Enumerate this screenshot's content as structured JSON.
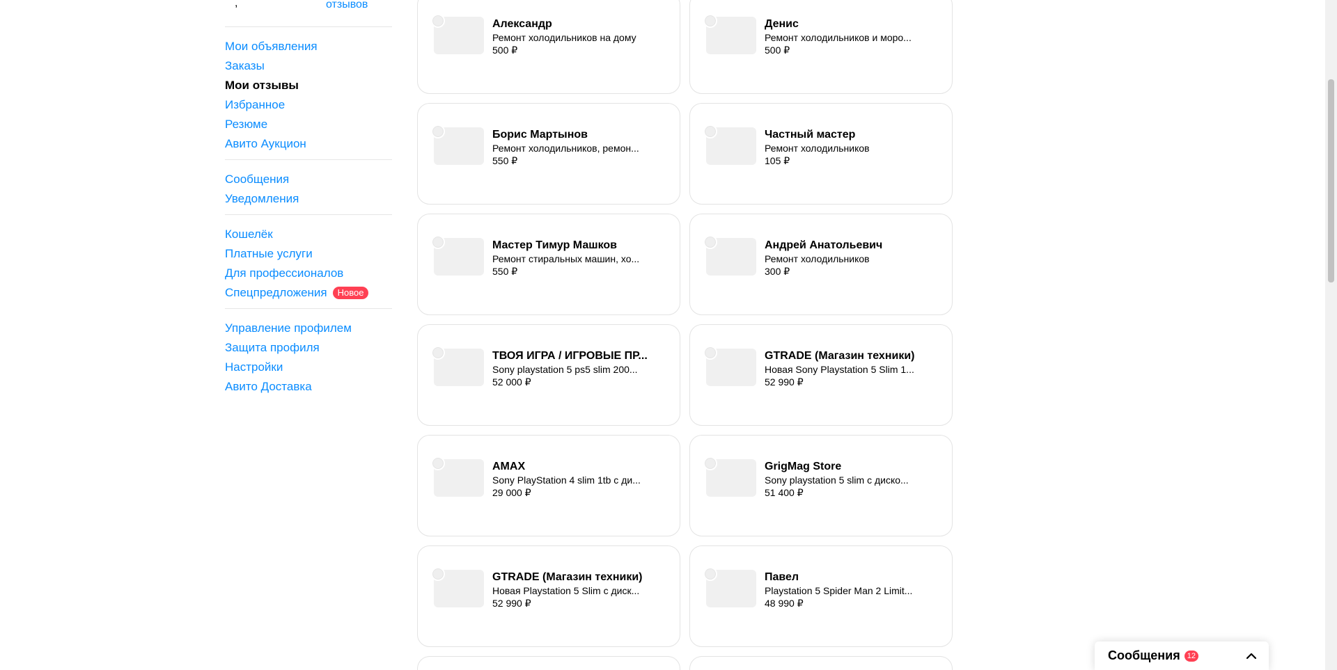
{
  "sidebar": {
    "top_fragment": {
      "reviews_text": "отзывов"
    },
    "groups": [
      {
        "items": [
          {
            "label": "Мои объявления"
          },
          {
            "label": "Заказы"
          },
          {
            "label": "Мои отзывы",
            "active": true
          },
          {
            "label": "Избранное"
          },
          {
            "label": "Резюме"
          },
          {
            "label": "Авито Аукцион"
          }
        ]
      },
      {
        "items": [
          {
            "label": "Сообщения"
          },
          {
            "label": "Уведомления"
          }
        ]
      },
      {
        "items": [
          {
            "label": "Кошелёк"
          },
          {
            "label": "Платные услуги"
          },
          {
            "label": "Для профессионалов"
          },
          {
            "label": "Спецпредложения",
            "badge": "Новое"
          }
        ]
      },
      {
        "items": [
          {
            "label": "Управление профилем"
          },
          {
            "label": "Защита профиля"
          },
          {
            "label": "Настройки"
          },
          {
            "label": "Авито Доставка"
          }
        ]
      }
    ]
  },
  "cards": [
    {
      "name": "Александр",
      "desc": "Ремонт холодильников на дому",
      "price": "500 ₽"
    },
    {
      "name": "Денис",
      "desc": "Ремонт холодильников и моро...",
      "price": "500 ₽"
    },
    {
      "name": "Борис Мартынов",
      "desc": "Ремонт холодильников, ремон...",
      "price": "550 ₽"
    },
    {
      "name": "Частный мастер",
      "desc": "Ремонт холодильников",
      "price": "105 ₽"
    },
    {
      "name": "Мастер Тимур Машков",
      "desc": "Ремонт стиральных машин, хо...",
      "price": "550 ₽"
    },
    {
      "name": "Андрей Анатольевич",
      "desc": "Ремонт холодильников",
      "price": "300 ₽"
    },
    {
      "name": "ТВОЯ ИГРА / ИГРОВЫЕ ПР...",
      "desc": "Sony playstation 5 ps5 slim 200...",
      "price": "52 000 ₽"
    },
    {
      "name": "GTRADE (Магазин техники)",
      "desc": "Новая Sony Playstation 5 Slim 1...",
      "price": "52 990 ₽"
    },
    {
      "name": "AMAX",
      "desc": "Sony PlayStation 4 slim 1tb с ди...",
      "price": "29 000 ₽"
    },
    {
      "name": "GrigMag Store",
      "desc": "Sony playstation 5 slim с диско...",
      "price": "51 400 ₽"
    },
    {
      "name": "GTRADE (Магазин техники)",
      "desc": "Новая Playstation 5 Slim с диск...",
      "price": "52 990 ₽"
    },
    {
      "name": "Павел",
      "desc": "Playstation 5 Spider Man 2 Limit...",
      "price": "48 990 ₽"
    }
  ],
  "messenger": {
    "label": "Сообщения",
    "count": "12"
  },
  "icons": {
    "chevron": "chevron-up-icon"
  },
  "colors": {
    "link": "#0a8cff",
    "badge": "#ff4053"
  }
}
